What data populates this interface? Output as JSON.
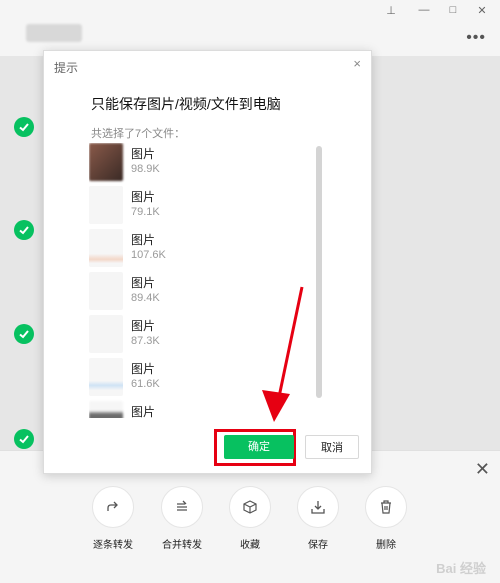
{
  "window": {
    "pin": "⊥",
    "minimize": "—",
    "maximize": "□",
    "close": "✕",
    "more": "•••"
  },
  "dialog": {
    "title": "提示",
    "close": "×",
    "heading": "只能保存图片/视频/文件到电脑",
    "count_text": "共选择了7个文件：",
    "files": [
      {
        "name": "图片",
        "size": "98.9K"
      },
      {
        "name": "图片",
        "size": "79.1K"
      },
      {
        "name": "图片",
        "size": "107.6K"
      },
      {
        "name": "图片",
        "size": "89.4K"
      },
      {
        "name": "图片",
        "size": "87.3K"
      },
      {
        "name": "图片",
        "size": "61.6K"
      },
      {
        "name": "图片",
        "size": ""
      }
    ],
    "confirm_label": "确定",
    "cancel_label": "取消"
  },
  "bottom": {
    "close": "✕",
    "actions": [
      {
        "label": "逐条转发",
        "icon": "forward-icon"
      },
      {
        "label": "合并转发",
        "icon": "merge-forward-icon"
      },
      {
        "label": "收藏",
        "icon": "favorite-icon"
      },
      {
        "label": "保存",
        "icon": "save-icon"
      },
      {
        "label": "删除",
        "icon": "delete-icon"
      }
    ]
  },
  "watermark": "Bai 经验",
  "colors": {
    "accent": "#07c160",
    "highlight": "#e60012"
  }
}
